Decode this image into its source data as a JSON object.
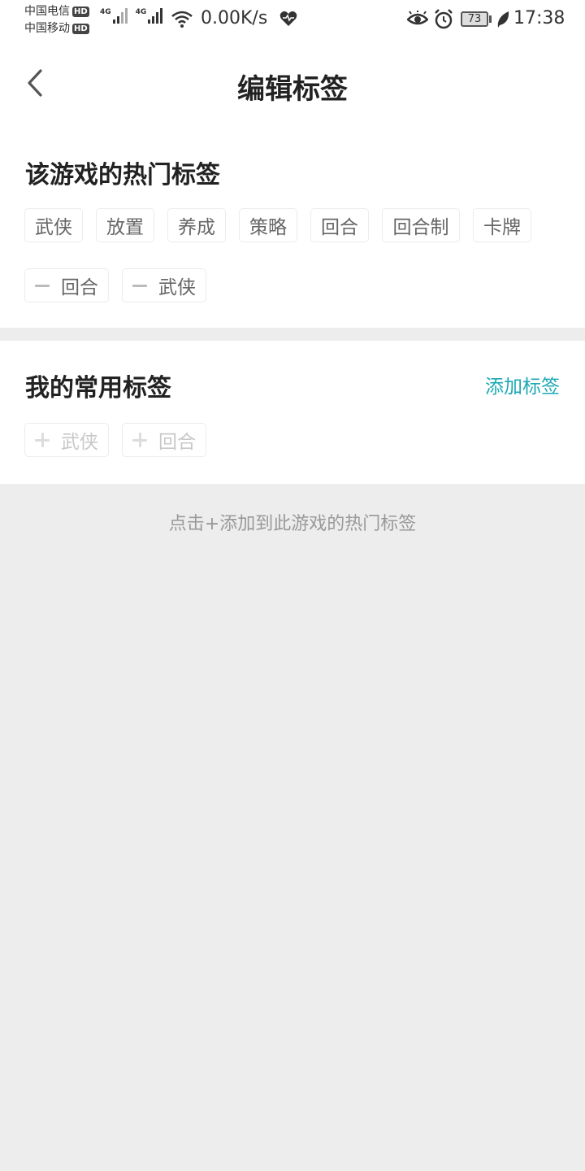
{
  "status_bar": {
    "carrier1": "中国电信",
    "carrier2": "中国移动",
    "hd_label": "HD",
    "network_type": "4G",
    "net_speed": "0.00K/s",
    "battery": "73",
    "time": "17:38",
    "icons": [
      "signal-icon",
      "wifi-icon",
      "heart-rate-icon",
      "eye-icon",
      "alarm-icon",
      "battery-icon",
      "leaf-icon"
    ]
  },
  "header": {
    "title": "编辑标签",
    "back_icon": "chevron-left-icon"
  },
  "hot_section": {
    "title": "该游戏的热门标签",
    "tags": [
      "武侠",
      "放置",
      "养成",
      "策略",
      "回合",
      "回合制",
      "卡牌"
    ],
    "removable_tags": [
      "回合",
      "武侠"
    ]
  },
  "my_section": {
    "title": "我的常用标签",
    "add_label": "添加标签",
    "tags": [
      "武侠",
      "回合"
    ]
  },
  "hint": "点击+添加到此游戏的热门标签",
  "colors": {
    "accent": "#1aa9b4",
    "background": "#ededed",
    "card": "#ffffff"
  }
}
